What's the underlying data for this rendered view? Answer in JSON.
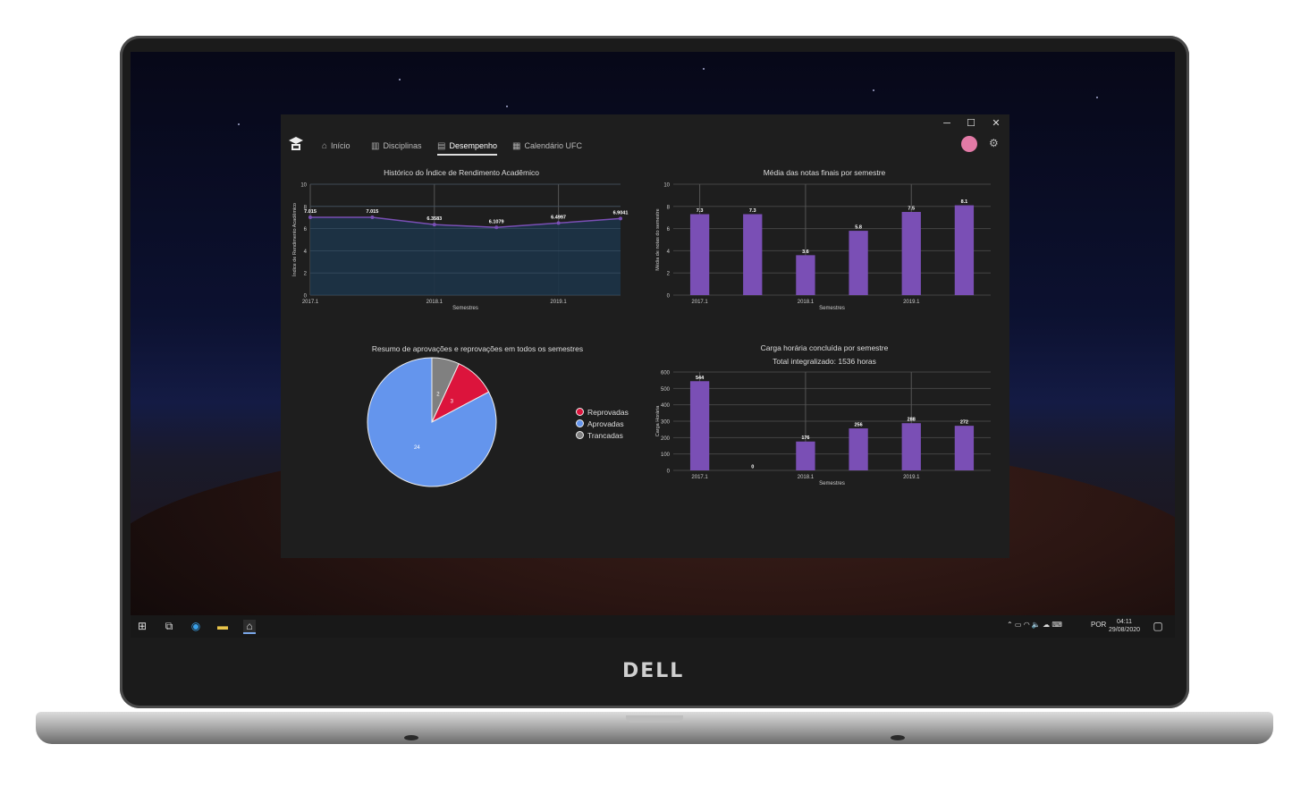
{
  "window": {
    "minimize": "─",
    "maximize": "☐",
    "close": "✕"
  },
  "nav": {
    "items": [
      {
        "label": "Início",
        "icon": "home-icon"
      },
      {
        "label": "Disciplinas",
        "icon": "books-icon"
      },
      {
        "label": "Desempenho",
        "icon": "chart-icon"
      },
      {
        "label": "Calendário UFC",
        "icon": "calendar-icon"
      }
    ],
    "active": "Desempenho"
  },
  "taskbar": {
    "language": "POR",
    "time": "04:11",
    "date": "29/08/2020"
  },
  "brand": {
    "logo_text": "DELL"
  },
  "colors": {
    "bar": "#7a4fb5",
    "line": "#7a4fb5",
    "area": "#1c3347",
    "reprovadas": "#dc143c",
    "aprovadas": "#6495ed",
    "trancadas": "#808080"
  },
  "chart_data": [
    {
      "type": "area",
      "title": "Histórico do Índice de Rendimento Acadêmico",
      "xlabel": "Semestres",
      "ylabel": "Índice de Rendimento Acadêmico",
      "ylim": [
        0,
        10
      ],
      "yticks": [
        "0",
        "2",
        "4",
        "6",
        "8",
        "10"
      ],
      "xticks": [
        "2017.1",
        "2018.1",
        "2019.1"
      ],
      "values": [
        7.015,
        7.015,
        6.3583,
        6.1079,
        6.4997,
        6.9041
      ],
      "labels": [
        "7.015",
        "7.015",
        "6.3583",
        "6.1079",
        "6.4997",
        "6.9041"
      ]
    },
    {
      "type": "bar",
      "title": "Média das notas finais por semestre",
      "xlabel": "Semestres",
      "ylabel": "Média de notas do semestre",
      "ylim": [
        0,
        10
      ],
      "yticks": [
        "0",
        "2",
        "4",
        "6",
        "8",
        "10"
      ],
      "xticks": [
        "2017.1",
        "2018.1",
        "2019.1"
      ],
      "values": [
        7.3,
        7.3,
        3.6,
        5.8,
        7.5,
        8.1
      ],
      "labels": [
        "7.3",
        "7.3",
        "3.6",
        "5.8",
        "7.5",
        "8.1"
      ]
    },
    {
      "type": "pie",
      "title": "Resumo de aprovações e reprovações em todos os semestres",
      "slices": [
        {
          "name": "Reprovadas",
          "value": 3
        },
        {
          "name": "Aprovadas",
          "value": 24
        },
        {
          "name": "Trancadas",
          "value": 2
        }
      ],
      "legend_position": "right"
    },
    {
      "type": "bar",
      "title": "Carga horária concluída por semestre",
      "subtitle": "Total integralizado: 1536 horas",
      "xlabel": "Semestres",
      "ylabel": "Carga Horária",
      "ylim": [
        0,
        600
      ],
      "yticks": [
        "0",
        "100",
        "200",
        "300",
        "400",
        "500",
        "600"
      ],
      "xticks": [
        "2017.1",
        "2018.1",
        "2019.1"
      ],
      "values": [
        544,
        0,
        176,
        256,
        288,
        272
      ],
      "labels": [
        "544",
        "0",
        "176",
        "256",
        "288",
        "272"
      ]
    }
  ]
}
